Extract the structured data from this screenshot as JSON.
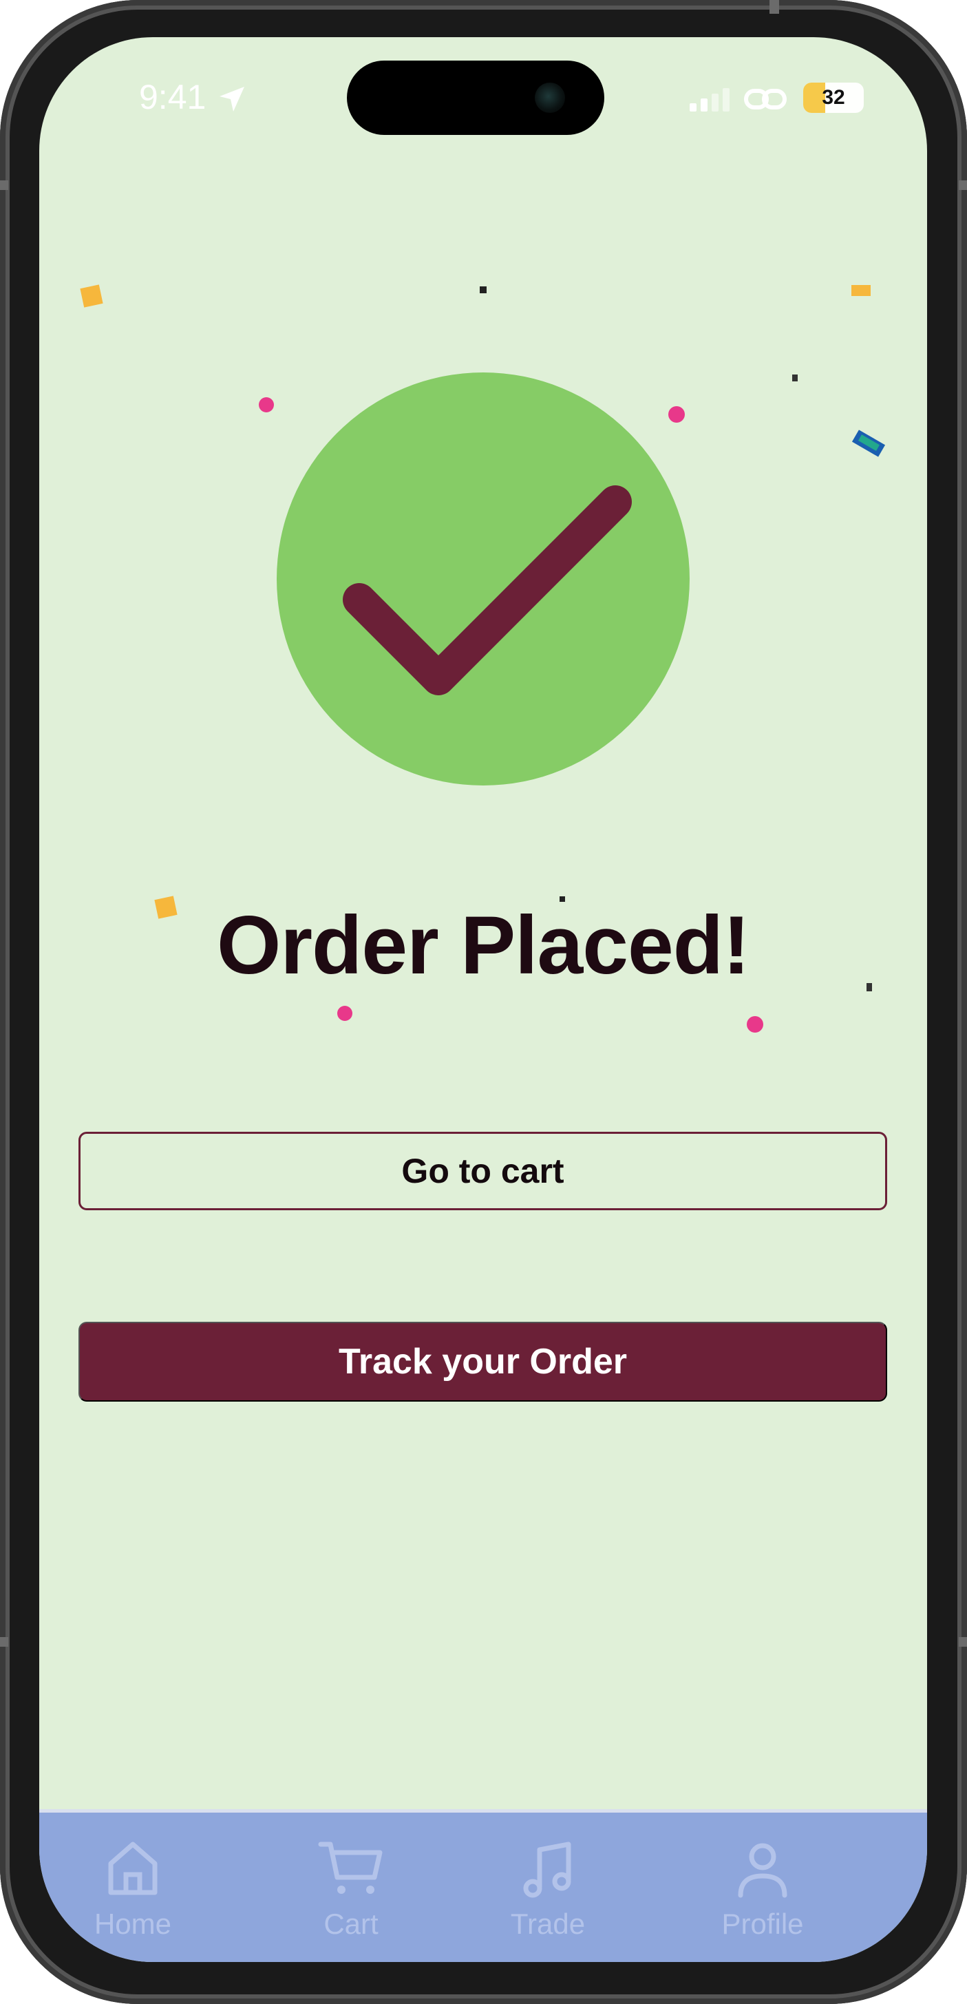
{
  "status_bar": {
    "time": "9:41",
    "battery": "32"
  },
  "main": {
    "title": "Order Placed!",
    "secondary_button": "Go to cart",
    "primary_button": "Track your Order"
  },
  "tabbar": {
    "items": [
      {
        "label": "Home",
        "icon": "home-icon"
      },
      {
        "label": "Cart",
        "icon": "cart-icon"
      },
      {
        "label": "Trade",
        "icon": "music-note-icon"
      },
      {
        "label": "Profile",
        "icon": "person-icon"
      }
    ]
  },
  "colors": {
    "background": "#e0f0d8",
    "success_circle": "#86cc66",
    "check_mark": "#6b2037",
    "accent": "#6b2037",
    "tabbar": "#8ea6dc",
    "tab_icon": "#b3c3ea"
  }
}
